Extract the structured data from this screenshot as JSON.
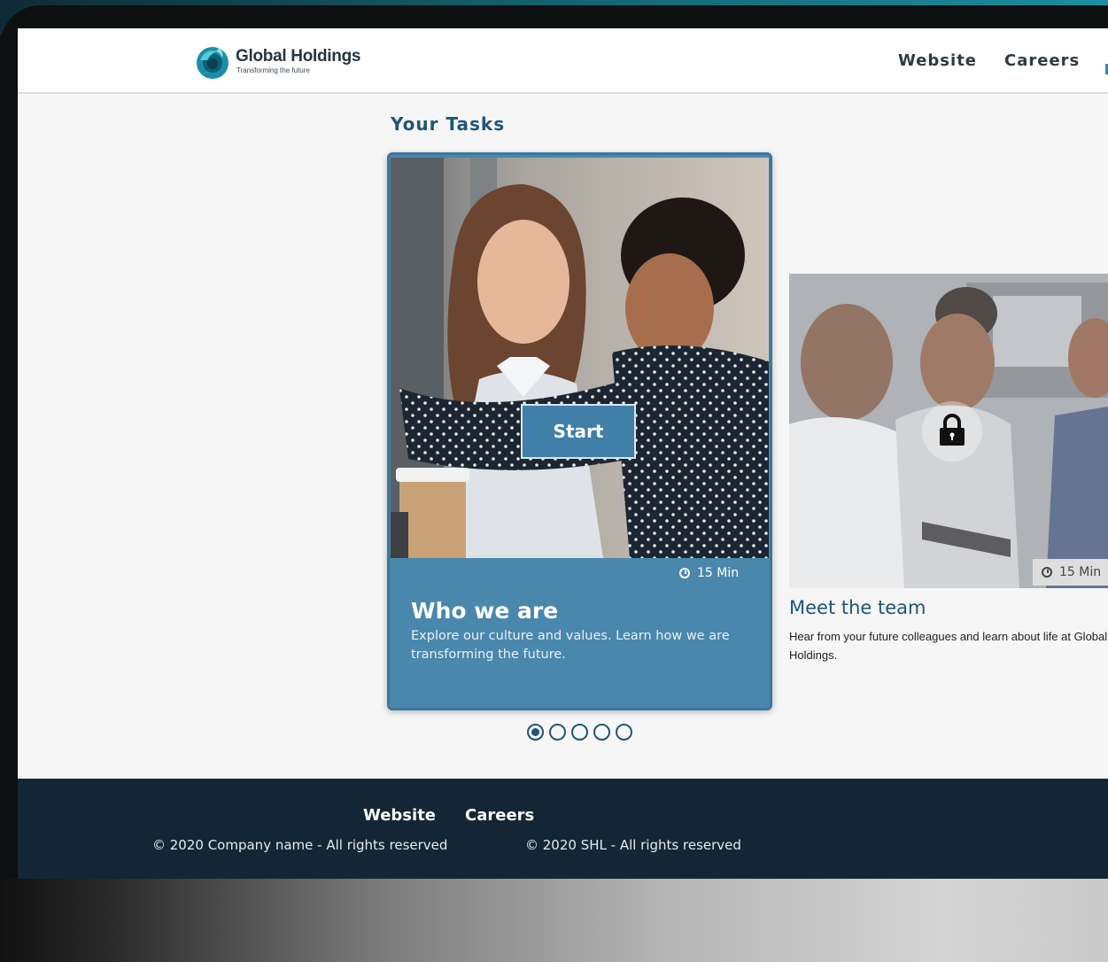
{
  "brand": {
    "name": "Global Holdings",
    "tagline": "Transforming the future"
  },
  "header": {
    "nav": [
      "Website",
      "Careers"
    ]
  },
  "main": {
    "section_title": "Your Tasks",
    "active_card": {
      "title": "Who we are",
      "description": "Explore our culture and values. Learn how we are transforming the future.",
      "duration": "15 Min",
      "button_label": "Start"
    },
    "next_card": {
      "title": "Meet the team",
      "description": "Hear from your future colleagues and learn about life at Global Holdings.",
      "duration": "15 Min",
      "locked": true
    },
    "pagination": {
      "total": 5,
      "current": 1
    }
  },
  "footer": {
    "links": [
      "Website",
      "Careers"
    ],
    "copyright_company": "© 2020 Company name - All rights reserved",
    "copyright_shl": "© 2020 SHL - All rights reserved"
  },
  "colors": {
    "accent": "#4a87ad",
    "heading": "#1f5577",
    "footer_bg": "#142636"
  }
}
